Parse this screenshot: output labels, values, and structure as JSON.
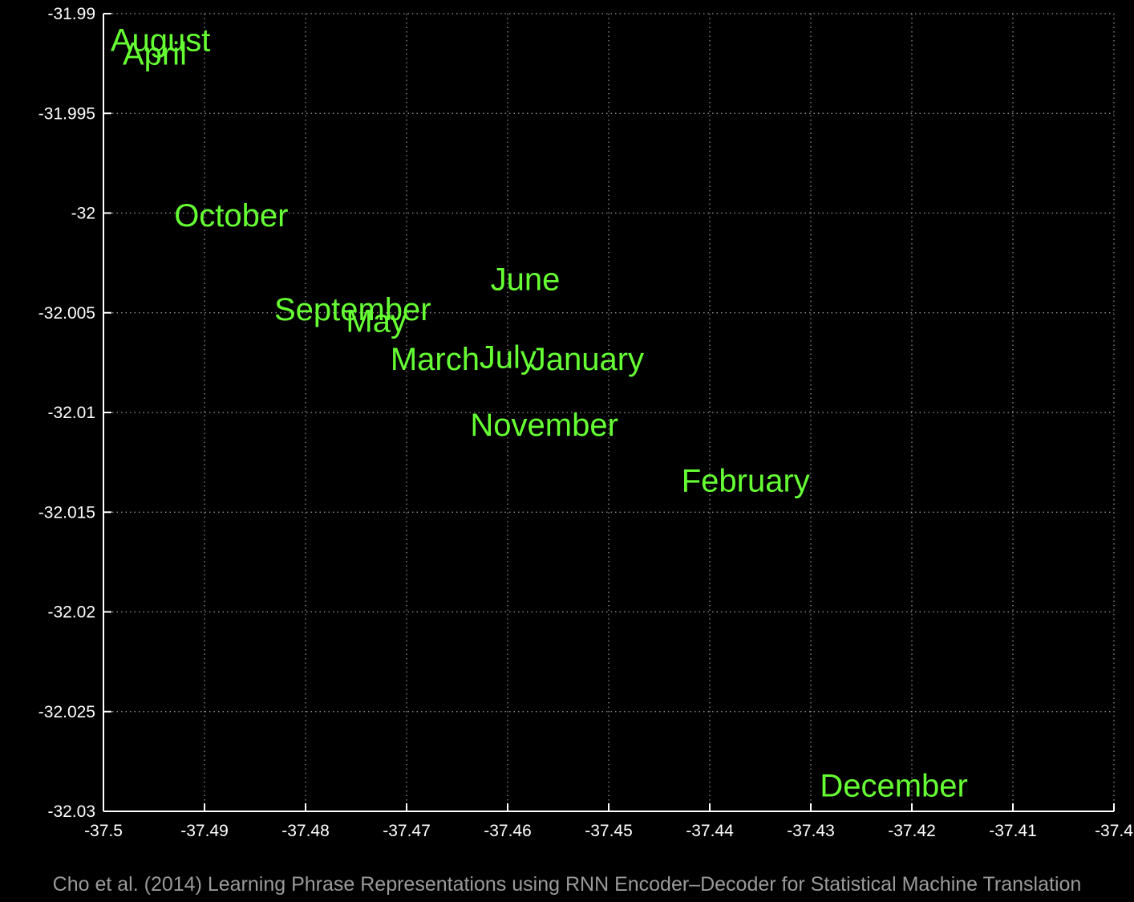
{
  "chart_data": {
    "type": "scatter",
    "marker": "text-label",
    "label_color": "#66ff33",
    "background": "#000000",
    "grid": true,
    "xlim": [
      -37.5,
      -37.4
    ],
    "ylim": [
      -32.03,
      -31.99
    ],
    "x_ticks": [
      -37.5,
      -37.49,
      -37.48,
      -37.47,
      -37.46,
      -37.45,
      -37.44,
      -37.43,
      -37.42,
      -37.41,
      -37.4
    ],
    "x_tick_labels": [
      "-37.5",
      "-37.49",
      "-37.48",
      "-37.47",
      "-37.46",
      "-37.45",
      "-37.44",
      "-37.43",
      "-37.42",
      "-37.41",
      "-37.4"
    ],
    "y_ticks": [
      -31.99,
      -31.995,
      -32,
      -32.005,
      -32.01,
      -32.015,
      -32.02,
      -32.025,
      -32.03
    ],
    "y_tick_labels": [
      "-31.99",
      "-31.995",
      "-32",
      "-32.005",
      "-32.01",
      "-32.015",
      "-32.02",
      "-32.025",
      "-32.03"
    ],
    "points": [
      {
        "label": "August",
        "x": -37.4993,
        "y": -31.9913
      },
      {
        "label": "April",
        "x": -37.4981,
        "y": -31.992
      },
      {
        "label": "October",
        "x": -37.493,
        "y": -32.0001
      },
      {
        "label": "September",
        "x": -37.4831,
        "y": -32.0048
      },
      {
        "label": "May",
        "x": -37.476,
        "y": -32.0054
      },
      {
        "label": "June",
        "x": -37.4617,
        "y": -32.0033
      },
      {
        "label": "July",
        "x": -37.4628,
        "y": -32.0072
      },
      {
        "label": "March",
        "x": -37.4716,
        "y": -32.0073
      },
      {
        "label": "January",
        "x": -37.4578,
        "y": -32.0073
      },
      {
        "label": "November",
        "x": -37.4637,
        "y": -32.0106
      },
      {
        "label": "February",
        "x": -37.4428,
        "y": -32.0134
      },
      {
        "label": "December",
        "x": -37.4291,
        "y": -32.0287
      }
    ]
  },
  "citation": "Cho et al. (2014) Learning Phrase Representations using RNN Encoder–Decoder for Statistical Machine Translation"
}
